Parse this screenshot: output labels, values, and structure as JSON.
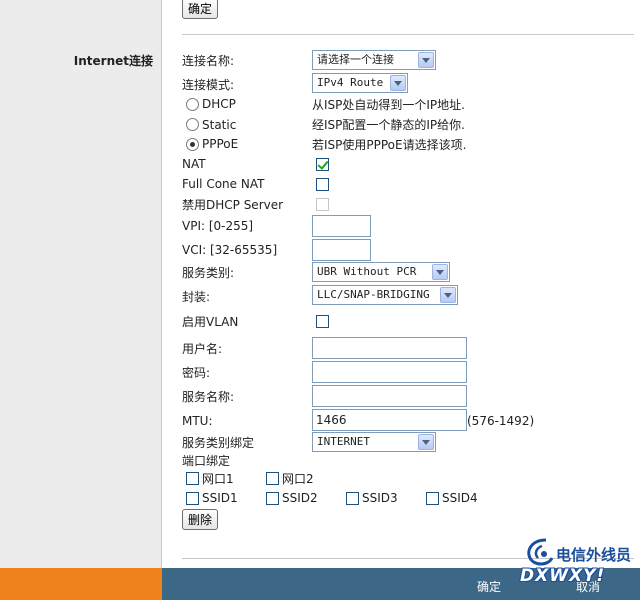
{
  "sidebar": {
    "section_title": "Internet连接"
  },
  "top": {
    "confirm_label": "确定"
  },
  "form": {
    "connection_name": {
      "label": "连接名称:",
      "value": "请选择一个连接"
    },
    "connection_mode": {
      "label": "连接模式:",
      "value": "IPv4 Route"
    },
    "modes": [
      {
        "label": "DHCP",
        "desc": "从ISP处自动得到一个IP地址.",
        "checked": false
      },
      {
        "label": "Static",
        "desc": "经ISP配置一个静态的IP给你.",
        "checked": false
      },
      {
        "label": "PPPoE",
        "desc": "若ISP使用PPPoE请选择该项.",
        "checked": true
      }
    ],
    "nat": {
      "label": "NAT",
      "checked": true
    },
    "full_cone_nat": {
      "label": "Full Cone NAT",
      "checked": false
    },
    "disable_dhcp": {
      "label": "禁用DHCP Server",
      "checked": false
    },
    "vpi": {
      "label": "VPI: [0-255]",
      "value": ""
    },
    "vci": {
      "label": "VCI: [32-65535]",
      "value": ""
    },
    "service_type": {
      "label": "服务类别:",
      "value": "UBR Without PCR"
    },
    "encapsulation": {
      "label": "封装:",
      "value": "LLC/SNAP-BRIDGING"
    },
    "enable_vlan": {
      "label": "启用VLAN",
      "checked": false
    },
    "username": {
      "label": "用户名:",
      "value": ""
    },
    "password": {
      "label": "密码:",
      "value": ""
    },
    "service_name": {
      "label": "服务名称:",
      "value": ""
    },
    "mtu": {
      "label": "MTU:",
      "value": "1466",
      "range": "(576-1492)"
    },
    "service_binding": {
      "label": "服务类别绑定",
      "value": "INTERNET"
    },
    "port_binding": {
      "label": "端口绑定",
      "ports": [
        {
          "label": "网口1",
          "checked": false
        },
        {
          "label": "网口2",
          "checked": false
        },
        {
          "label": "SSID1",
          "checked": false
        },
        {
          "label": "SSID2",
          "checked": false
        },
        {
          "label": "SSID3",
          "checked": false
        },
        {
          "label": "SSID4",
          "checked": false
        }
      ]
    },
    "delete_label": "删除"
  },
  "footer": {
    "confirm_label": "确定",
    "cancel_label": "取消"
  },
  "watermark": {
    "name": "电信外线员",
    "site": "DXWXY!"
  },
  "colors": {
    "footer_orange": "#f0821e",
    "footer_blue": "#3c6786",
    "checkmark": "#21a121"
  }
}
